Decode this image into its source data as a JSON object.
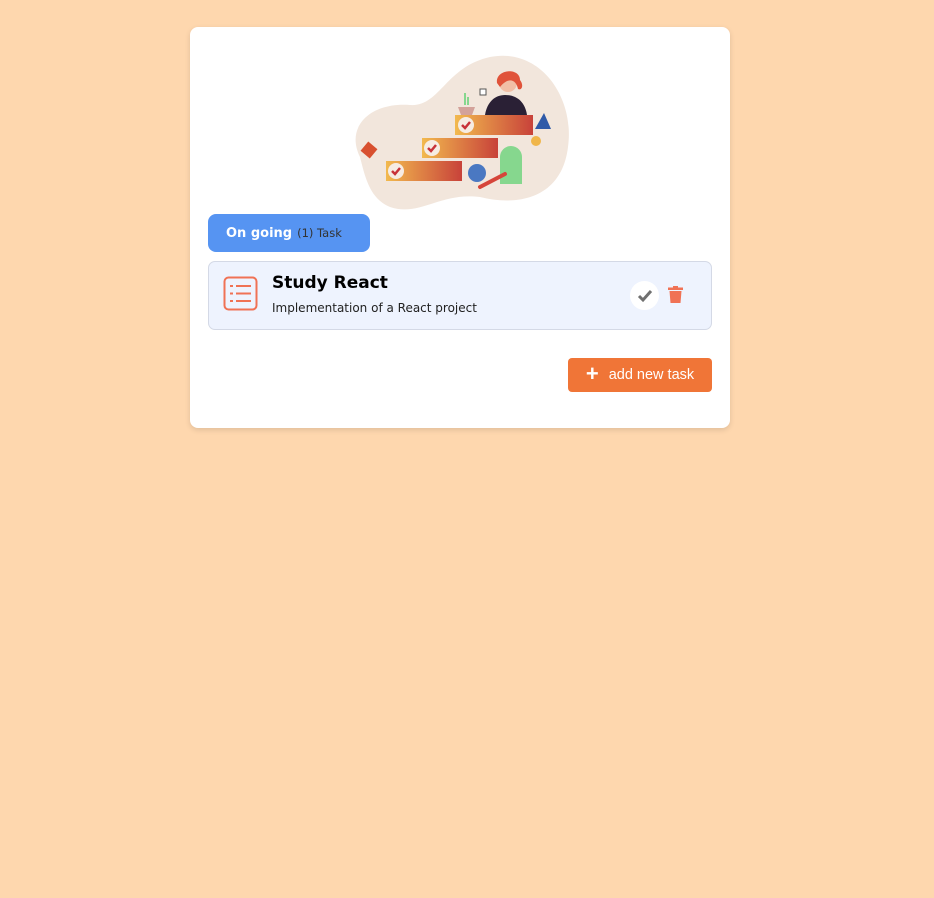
{
  "status": {
    "label": "On going",
    "count_text": "(1) Task"
  },
  "tasks": [
    {
      "title": "Study React",
      "description": "Implementation of a React project"
    }
  ],
  "actions": {
    "add_label": "add new task",
    "add_icon": "plus-icon"
  },
  "colors": {
    "background": "#fed7ae",
    "badge": "#5694f2",
    "accent": "#f07537",
    "task_bg": "#eef3fe"
  }
}
